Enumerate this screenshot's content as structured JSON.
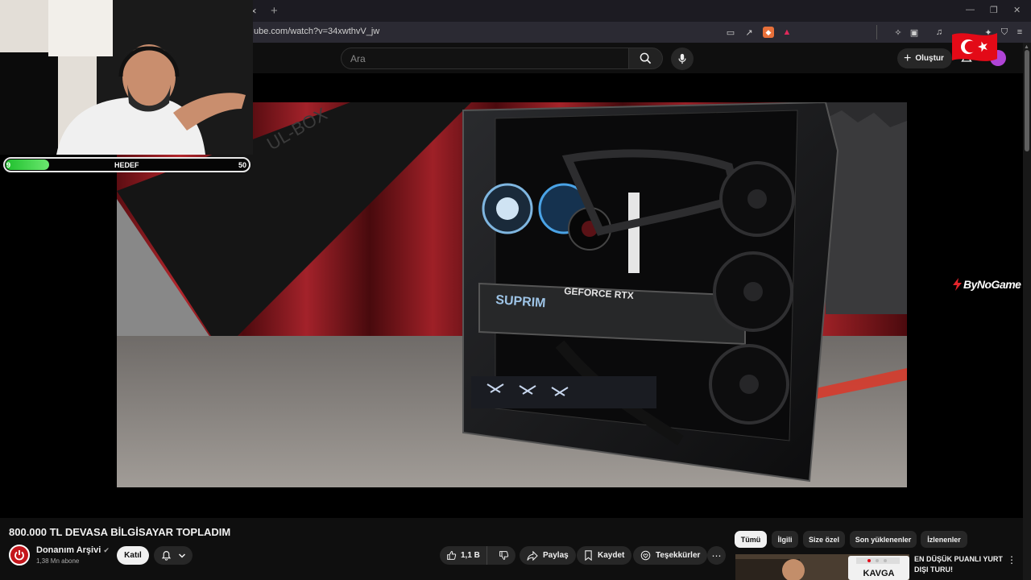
{
  "browser": {
    "url": "ube.com/watch?v=34xwthvV_jw",
    "tab_close": "×",
    "tab_new": "+"
  },
  "header": {
    "search_placeholder": "Ara",
    "create_label": "Oluştur"
  },
  "overlay": {
    "goal_label": "HEDEF",
    "goal_current": "9",
    "goal_target": "50",
    "goal_progress": 0.18,
    "brand_text": "ByNoGame"
  },
  "video": {
    "title": "800.000 TL DEVASA BİLGİSAYAR TOPLADIM",
    "scene_text": "UL-BOX",
    "gpu_text": "GEFORCE RTX",
    "gpu_brand": "SUPRIM"
  },
  "channel": {
    "name": "Donanım Arşivi",
    "subscribers": "1,38 Mn abone",
    "join_label": "Katıl"
  },
  "actions": {
    "like_count": "1,1 B",
    "share_label": "Paylaş",
    "save_label": "Kaydet",
    "thanks_label": "Teşekkürler",
    "more_label": "⋯"
  },
  "chips": [
    "Tümü",
    "İlgili",
    "Size özel",
    "Son yüklenenler",
    "İzlenenler"
  ],
  "recommendation": {
    "title": "EN DÜŞÜK PUANLI YURT DIŞI TURU!",
    "thumb_text": "KAVGA"
  },
  "colors": {
    "accent_red": "#c4161c",
    "goal_green": "#1fbf2d",
    "avatar_purple": "#b044d6"
  }
}
